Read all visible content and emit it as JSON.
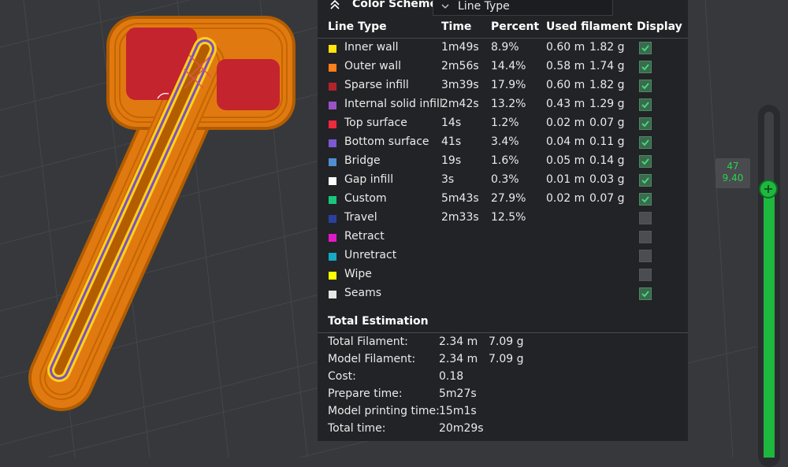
{
  "color_scheme": {
    "title": "Color Scheme",
    "selected": "Line Type",
    "chevron_icon": "double-chevron-up-icon",
    "dropdown_icon": "chevron-down-icon"
  },
  "legend": {
    "headers": {
      "type": "Line Type",
      "time": "Time",
      "percent": "Percent",
      "filament": "Used filament",
      "display": "Display"
    },
    "rows": [
      {
        "label": "Inner wall",
        "color": "#ffe50c",
        "time": "1m49s",
        "percent": "8.9%",
        "length": "0.60 m",
        "weight": "1.82 g",
        "display": true
      },
      {
        "label": "Outer wall",
        "color": "#ff7f1a",
        "time": "2m56s",
        "percent": "14.4%",
        "length": "0.58 m",
        "weight": "1.74 g",
        "display": true
      },
      {
        "label": "Sparse infill",
        "color": "#b3232a",
        "time": "3m39s",
        "percent": "17.9%",
        "length": "0.60 m",
        "weight": "1.82 g",
        "display": true
      },
      {
        "label": "Internal solid infill",
        "color": "#9a52c7",
        "time": "2m42s",
        "percent": "13.2%",
        "length": "0.43 m",
        "weight": "1.29 g",
        "display": true
      },
      {
        "label": "Top surface",
        "color": "#f0293d",
        "time": "14s",
        "percent": "1.2%",
        "length": "0.02 m",
        "weight": "0.07 g",
        "display": true
      },
      {
        "label": "Bottom surface",
        "color": "#7b58d6",
        "time": "41s",
        "percent": "3.4%",
        "length": "0.04 m",
        "weight": "0.11 g",
        "display": true
      },
      {
        "label": "Bridge",
        "color": "#4f8fcf",
        "time": "19s",
        "percent": "1.6%",
        "length": "0.05 m",
        "weight": "0.14 g",
        "display": true
      },
      {
        "label": "Gap infill",
        "color": "#ffffff",
        "time": "3s",
        "percent": "0.3%",
        "length": "0.01 m",
        "weight": "0.03 g",
        "display": true
      },
      {
        "label": "Custom",
        "color": "#19c77a",
        "time": "5m43s",
        "percent": "27.9%",
        "length": "0.02 m",
        "weight": "0.07 g",
        "display": true
      },
      {
        "label": "Travel",
        "color": "#2a3f9e",
        "time": "2m33s",
        "percent": "12.5%",
        "length": "",
        "weight": "",
        "display": false
      },
      {
        "label": "Retract",
        "color": "#e11ac7",
        "time": "",
        "percent": "",
        "length": "",
        "weight": "",
        "display": false
      },
      {
        "label": "Unretract",
        "color": "#13a9c7",
        "time": "",
        "percent": "",
        "length": "",
        "weight": "",
        "display": false
      },
      {
        "label": "Wipe",
        "color": "#ffff00",
        "time": "",
        "percent": "",
        "length": "",
        "weight": "",
        "display": false
      },
      {
        "label": "Seams",
        "color": "#e6e6e6",
        "time": "",
        "percent": "",
        "length": "",
        "weight": "",
        "display": true
      }
    ]
  },
  "totals": {
    "title": "Total Estimation",
    "rows": [
      {
        "label": "Total Filament:",
        "value": "2.34 m",
        "value2": "7.09 g"
      },
      {
        "label": "Model Filament:",
        "value": "2.34 m",
        "value2": "7.09 g"
      },
      {
        "label": "Cost:",
        "value": "0.18",
        "value2": ""
      },
      {
        "label": "Prepare time:",
        "value": "5m27s",
        "value2": ""
      },
      {
        "label": "Model printing time:",
        "value": "15m1s",
        "value2": ""
      },
      {
        "label": "Total time:",
        "value": "20m29s",
        "value2": ""
      }
    ]
  },
  "layer_slider": {
    "layer": "47",
    "height": "9.40",
    "handle_icon": "plus-icon",
    "accent": "#1fb83f"
  }
}
